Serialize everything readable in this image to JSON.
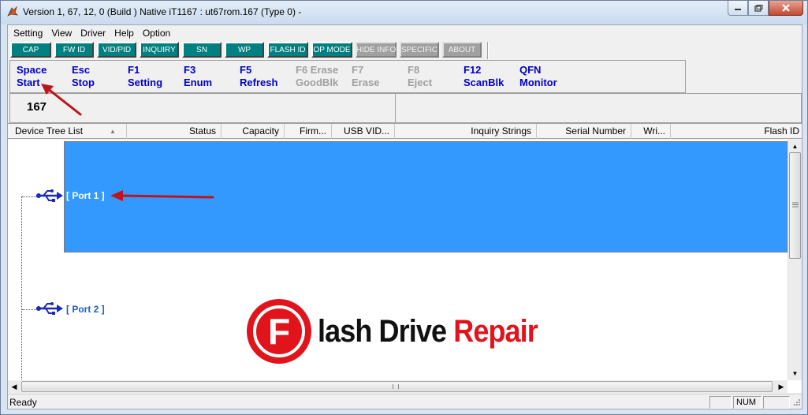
{
  "window": {
    "title": "Version 1, 67, 12, 0 (Build )  Native iT1167 : ut67rom.167  (Type 0)  -"
  },
  "menu": [
    {
      "label": "Setting"
    },
    {
      "label": "View"
    },
    {
      "label": "Driver"
    },
    {
      "label": "Help"
    },
    {
      "label": "Option"
    }
  ],
  "mode_buttons": [
    {
      "label": "CAP",
      "active": true
    },
    {
      "label": "FW ID",
      "active": true
    },
    {
      "label": "VID/PID",
      "active": true
    },
    {
      "label": "INQUIRY",
      "active": true
    },
    {
      "label": "SN",
      "active": true
    },
    {
      "label": "WP",
      "active": true
    },
    {
      "label": "FLASH ID",
      "active": true
    },
    {
      "label": "OP MODE",
      "active": true
    },
    {
      "label": "HIDE INFO",
      "active": false
    },
    {
      "label": "SPECIFIC",
      "active": false
    },
    {
      "label": "ABOUT",
      "active": false
    }
  ],
  "hotkeys": [
    {
      "key": "Space",
      "action": "Start",
      "enabled": true
    },
    {
      "key": "Esc",
      "action": "Stop",
      "enabled": true
    },
    {
      "key": "F1",
      "action": "Setting",
      "enabled": true
    },
    {
      "key": "F3",
      "action": "Enum",
      "enabled": true
    },
    {
      "key": "F5",
      "action": "Refresh",
      "enabled": true
    },
    {
      "key": "F6 Erase",
      "action": "GoodBlk",
      "enabled": false
    },
    {
      "key": "F7",
      "action": "Erase",
      "enabled": false
    },
    {
      "key": "F8",
      "action": "Eject",
      "enabled": false
    },
    {
      "key": "F12",
      "action": "ScanBlk",
      "enabled": true
    },
    {
      "key": "QFN",
      "action": "Monitor",
      "enabled": true
    }
  ],
  "info": {
    "count": "167"
  },
  "columns": [
    {
      "label": "Device Tree List",
      "sort": "▲"
    },
    {
      "label": "Status"
    },
    {
      "label": "Capacity"
    },
    {
      "label": "Firm..."
    },
    {
      "label": "USB VID..."
    },
    {
      "label": "Inquiry Strings"
    },
    {
      "label": "Serial Number"
    },
    {
      "label": "Wri..."
    },
    {
      "label": "Flash ID"
    }
  ],
  "ports": [
    {
      "label": "[ Port 1 ]",
      "selected": true
    },
    {
      "label": "[ Port 2 ]",
      "selected": false
    }
  ],
  "status": {
    "text": "Ready",
    "num": "NUM"
  },
  "watermark": {
    "part1": "lash",
    "part2": "Drive",
    "part3": "Repair",
    "logo_letter": "F"
  },
  "colors": {
    "selection": "#3399ff",
    "hotkey_blue": "#0000c8",
    "mode_teal": "#008080",
    "annotation_red": "#c0141c",
    "logo_red": "#e1141c"
  }
}
